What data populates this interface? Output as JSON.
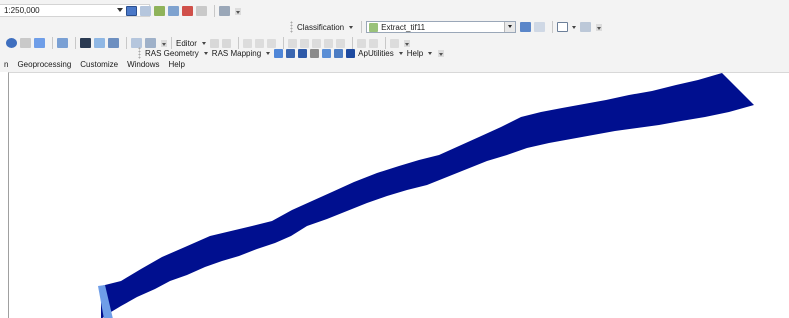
{
  "toolbar": {
    "scale_value": "1:250,000",
    "classification_label": "Classification",
    "layer_value": "Extract_tif11",
    "editor_label": "Editor",
    "ras_geometry_label": "RAS Geometry",
    "ras_mapping_label": "RAS Mapping",
    "aputilities_label": "ApUtilities",
    "help_label": "Help"
  },
  "menu": {
    "items": [
      "n",
      "Geoprocessing",
      "Customize",
      "Windows",
      "Help"
    ]
  },
  "colors": {
    "river_fill": "#000f8f",
    "highlight": "#6f9ee8"
  }
}
